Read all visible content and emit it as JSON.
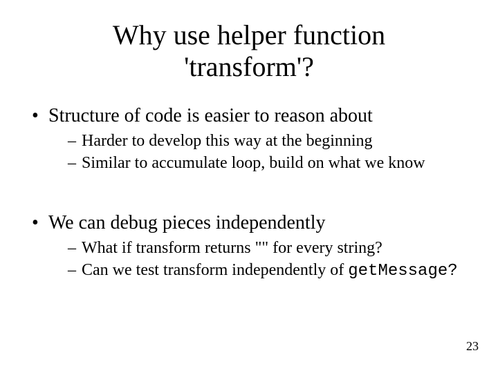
{
  "title": "Why use helper function 'transform'?",
  "bullets": [
    {
      "text": "Structure of code is easier to reason about",
      "sub": [
        "Harder to develop this way at the beginning",
        "Similar to accumulate loop, build on what we know"
      ]
    },
    {
      "text": "We can debug pieces independently",
      "sub": [
        "What if transform returns \"\" for every string?",
        "Can we test transform independently of "
      ]
    }
  ],
  "mono_trail": "getMessage?",
  "page_number": "23"
}
